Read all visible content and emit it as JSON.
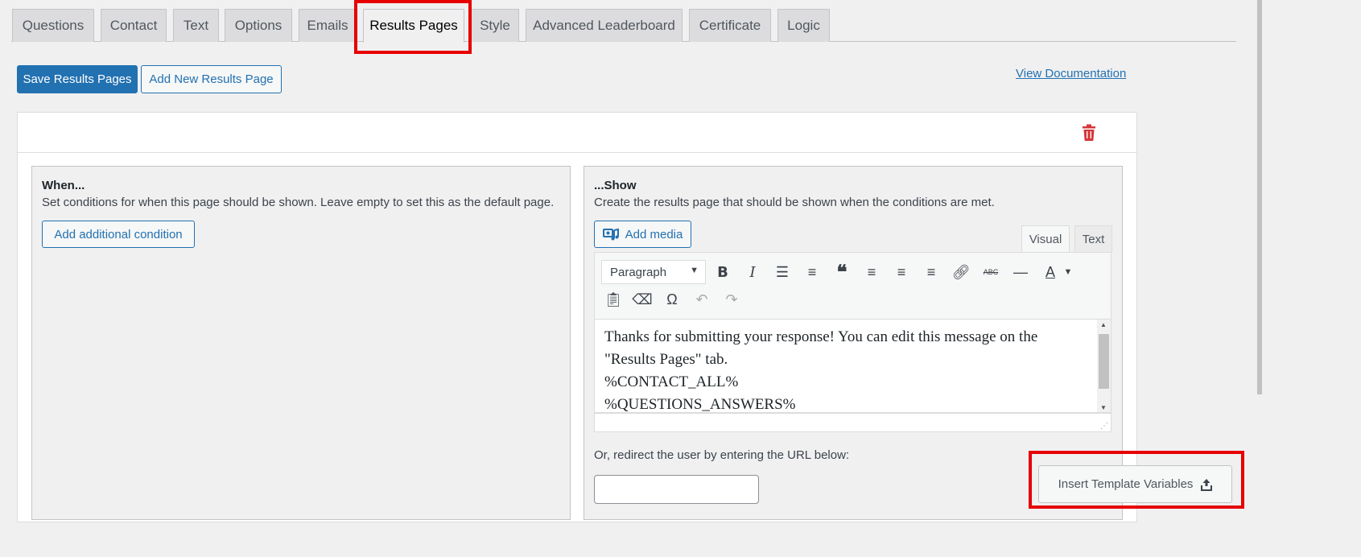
{
  "tabs": [
    {
      "label": "Questions"
    },
    {
      "label": "Contact"
    },
    {
      "label": "Text"
    },
    {
      "label": "Options"
    },
    {
      "label": "Emails"
    },
    {
      "label": "Results Pages",
      "active": true
    },
    {
      "label": "Style"
    },
    {
      "label": "Advanced Leaderboard"
    },
    {
      "label": "Certificate"
    },
    {
      "label": "Logic"
    }
  ],
  "actions": {
    "save_label": "Save Results Pages",
    "add_label": "Add New Results Page",
    "docs_label": "View Documentation"
  },
  "when_panel": {
    "title": "When...",
    "description": "Set conditions for when this page should be shown. Leave empty to set this as the default page.",
    "add_condition_label": "Add additional condition"
  },
  "show_panel": {
    "title": "...Show",
    "description": "Create the results page that should be shown when the conditions are met.",
    "add_media_label": "Add media",
    "editor_tabs": {
      "visual": "Visual",
      "text": "Text"
    },
    "format_select": "Paragraph",
    "content_lines": [
      "Thanks for submitting your response! You can edit this message on the",
      "\"Results Pages\" tab.",
      "%CONTACT_ALL%",
      "%QUESTIONS_ANSWERS%"
    ],
    "redirect_label": "Or, redirect the user by entering the URL below:",
    "redirect_value": ""
  },
  "insert_template_label": "Insert Template Variables",
  "colors": {
    "accent": "#2271b1",
    "highlight": "#e60000",
    "delete": "#d63638"
  }
}
